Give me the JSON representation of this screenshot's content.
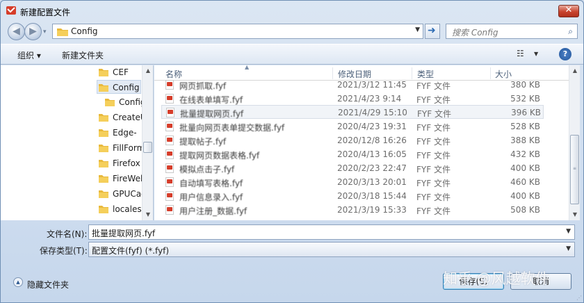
{
  "window": {
    "title": "新建配置文件"
  },
  "nav": {
    "back_glyph": "◀",
    "forward_glyph": "▶",
    "recent_glyph": "▾"
  },
  "address": {
    "path": "Config"
  },
  "search": {
    "placeholder": "搜索 Config"
  },
  "toolbar": {
    "organize_label": "组织 ▾",
    "new_folder_label": "新建文件夹"
  },
  "tree": {
    "items": [
      {
        "label": "CEF"
      },
      {
        "label": "Config"
      },
      {
        "label": "Config"
      },
      {
        "label": "CreateU"
      },
      {
        "label": "Edge-"
      },
      {
        "label": "FillForm"
      },
      {
        "label": "Firefox"
      },
      {
        "label": "FireWeb"
      },
      {
        "label": "GPUCac"
      },
      {
        "label": "locales"
      }
    ]
  },
  "files": {
    "columns": {
      "name": "名称",
      "date": "修改日期",
      "type": "类型",
      "size": "大小"
    },
    "rows": [
      {
        "name": "网页抓取.fyf",
        "date": "2021/3/12 11:45",
        "type": "FYF 文件",
        "size": "380 KB"
      },
      {
        "name": "在线表单填写.fyf",
        "date": "2021/4/23 9:14",
        "type": "FYF 文件",
        "size": "532 KB"
      },
      {
        "name": "批量提取网页.fyf",
        "date": "2021/4/29 15:10",
        "type": "FYF 文件",
        "size": "396 KB"
      },
      {
        "name": "批量向网页表单提交数据.fyf",
        "date": "2020/4/23 19:31",
        "type": "FYF 文件",
        "size": "528 KB"
      },
      {
        "name": "提取帖子.fyf",
        "date": "2020/12/8 16:26",
        "type": "FYF 文件",
        "size": "388 KB"
      },
      {
        "name": "提取网页数据表格.fyf",
        "date": "2020/4/13 16:05",
        "type": "FYF 文件",
        "size": "432 KB"
      },
      {
        "name": "模拟点击子.fyf",
        "date": "2020/2/23 22:47",
        "type": "FYF 文件",
        "size": "400 KB"
      },
      {
        "name": "自动填写表格.fyf",
        "date": "2020/3/13 20:01",
        "type": "FYF 文件",
        "size": "460 KB"
      },
      {
        "name": "用户信息录入.fyf",
        "date": "2020/3/18 15:44",
        "type": "FYF 文件",
        "size": "400 KB"
      },
      {
        "name": "用户注册_数据.fyf",
        "date": "2021/3/19 15:33",
        "type": "FYF 文件",
        "size": "508 KB"
      }
    ]
  },
  "form": {
    "filename_label": "文件名(N):",
    "filename_value": "批量提取网页.fyf",
    "savetype_label": "保存类型(T):",
    "savetype_value": "配置文件(fyf) (*.fyf)"
  },
  "footer": {
    "hide_folders_label": "隐藏文件夹",
    "save_label": "保存(S)",
    "cancel_label": "取消",
    "watermark": "知乎 @风越软件"
  },
  "colors": {
    "accent": "#2d6bb3",
    "close": "#c8442f",
    "file_icon": "#d63d2a"
  }
}
